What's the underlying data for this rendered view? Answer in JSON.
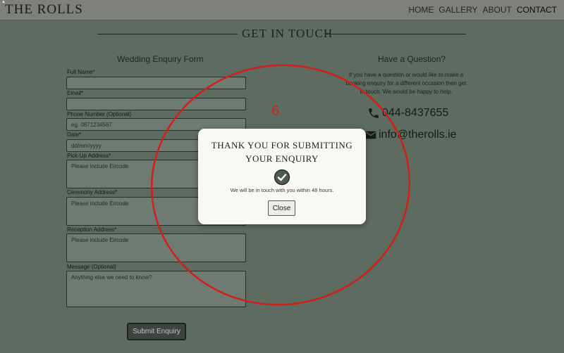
{
  "header": {
    "brand": "THE ROLLS",
    "nav": [
      "HOME",
      "GALLERY",
      "ABOUT",
      "CONTACT"
    ]
  },
  "section_title": "GET IN TOUCH",
  "form": {
    "title": "Wedding Enquiry Form",
    "fields": [
      {
        "label": "Full Name",
        "required": "*",
        "value": ""
      },
      {
        "label": "Email",
        "required": "*",
        "value": ""
      },
      {
        "label": "Phone Number (Optional)",
        "required": "",
        "placeholder": "eg. 0871234567"
      },
      {
        "label": "Date",
        "required": "*",
        "value": "dd/mm/yyyy"
      },
      {
        "label": "Pick-Up Address",
        "required": "*",
        "placeholder": "Please include Eircode"
      },
      {
        "label": "Ceremony Address",
        "required": "*",
        "placeholder": "Please include Eircode"
      },
      {
        "label": "Reception Address",
        "required": "*",
        "placeholder": "Please include Eircode"
      },
      {
        "label": "Message (Optional)",
        "required": "",
        "placeholder": "Anything else we need to know?"
      }
    ],
    "submit_label": "Submit Enquiry"
  },
  "question": {
    "title": "Have a Question?",
    "text": "If you have a question or would like to make a booking enquiry for a different occasion then get in touch. We would be happy to help.",
    "phone": "044-8437655",
    "email": "info@therolls.ie"
  },
  "annotation": {
    "number": "6",
    "color": "#d0201a"
  },
  "modal": {
    "title_line1": "THANK YOU FOR SUBMITTING",
    "title_line2": "YOUR ENQUIRY",
    "message": "We will be in touch with you within 48 hours.",
    "close_label": "Close"
  },
  "colors": {
    "background": "#5e6b60",
    "header": "#7e807a",
    "modal": "#f9f8f3",
    "annotation": "#d0201a"
  }
}
